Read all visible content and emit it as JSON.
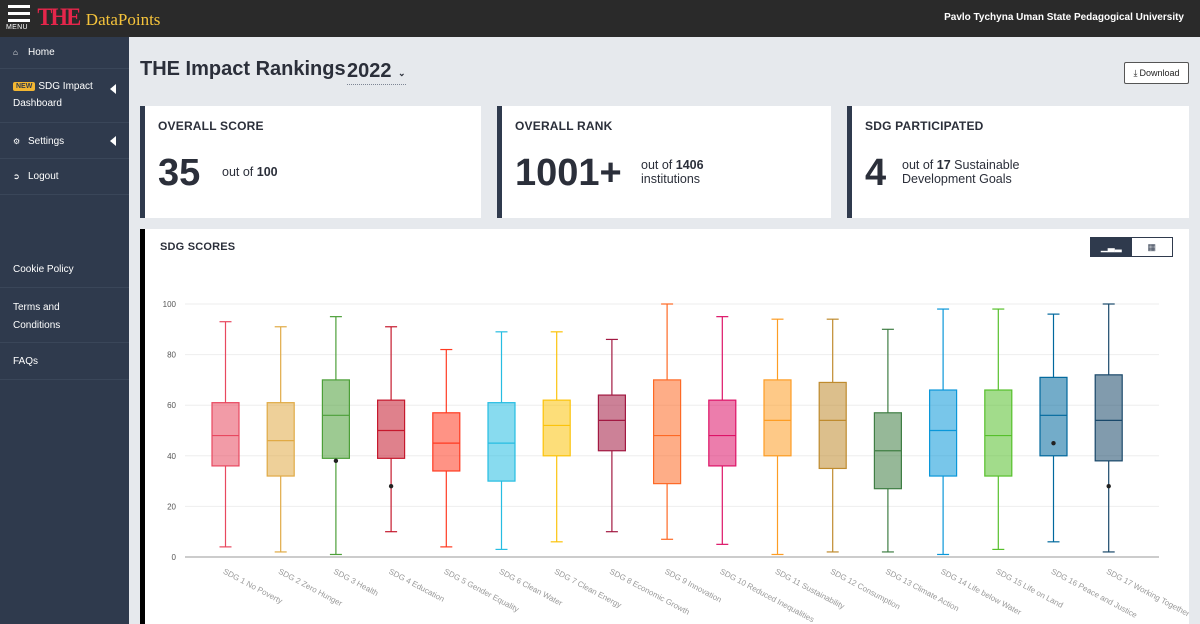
{
  "topbar": {
    "menu_label": "MENU",
    "logo_the": "THE",
    "logo_datapoints": "DataPoints",
    "university": "Pavlo Tychyna Uman State Pedagogical University"
  },
  "sidebar": {
    "home": "Home",
    "sdg_new_badge": "NEW",
    "sdg_line1": "SDG Impact",
    "sdg_line2": "Dashboard",
    "settings": "Settings",
    "logout": "Logout",
    "cookie": "Cookie Policy",
    "terms_line1": "Terms and",
    "terms_line2": "Conditions",
    "faqs": "FAQs"
  },
  "header": {
    "title": "THE Impact Rankings",
    "year": "2022",
    "download": "Download"
  },
  "cards": {
    "score": {
      "title": "OVERALL SCORE",
      "value": "35",
      "sub_prefix": "out of",
      "sub_bold": "100"
    },
    "rank": {
      "title": "OVERALL RANK",
      "value": "1001+",
      "sub_prefix": "out of",
      "sub_bold": "1406",
      "sub_line2": "institutions"
    },
    "sdg": {
      "title": "SDG PARTICIPATED",
      "value": "4",
      "sub_prefix": "out of",
      "sub_bold": "17",
      "sub_suffix": "Sustainable",
      "sub_line2": "Development Goals"
    }
  },
  "chart_section": {
    "title": "SDG SCORES"
  },
  "chart_data": {
    "type": "boxplot",
    "ylim": [
      0,
      100
    ],
    "yticks": [
      0,
      20,
      40,
      60,
      80,
      100
    ],
    "grid": true,
    "categories": [
      {
        "label": "SDG 1 No Poverty",
        "color": "#e8485f",
        "min": 4,
        "q1": 36,
        "median": 48,
        "q3": 61,
        "max": 93,
        "marker": null
      },
      {
        "label": "SDG 2 Zero Hunger",
        "color": "#e0aa45",
        "min": 2,
        "q1": 32,
        "median": 46,
        "q3": 61,
        "max": 91,
        "marker": null
      },
      {
        "label": "SDG 3 Health",
        "color": "#4c9f38",
        "min": 1,
        "q1": 39,
        "median": 56,
        "q3": 70,
        "max": 95,
        "marker": 38
      },
      {
        "label": "SDG 4 Education",
        "color": "#c5192d",
        "min": 10,
        "q1": 39,
        "median": 50,
        "q3": 62,
        "max": 91,
        "marker": 28
      },
      {
        "label": "SDG 5 Gender Equality",
        "color": "#ff3a21",
        "min": 4,
        "q1": 34,
        "median": 45,
        "q3": 57,
        "max": 82,
        "marker": null
      },
      {
        "label": "SDG 6 Clean Water",
        "color": "#26bde2",
        "min": 3,
        "q1": 30,
        "median": 45,
        "q3": 61,
        "max": 89,
        "marker": null
      },
      {
        "label": "SDG 7 Clean Energy",
        "color": "#fcc30b",
        "min": 6,
        "q1": 40,
        "median": 52,
        "q3": 62,
        "max": 89,
        "marker": null
      },
      {
        "label": "SDG 8 Economic Growth",
        "color": "#a21942",
        "min": 10,
        "q1": 42,
        "median": 54,
        "q3": 64,
        "max": 86,
        "marker": null
      },
      {
        "label": "SDG 9 Innovation",
        "color": "#fd6925",
        "min": 7,
        "q1": 29,
        "median": 48,
        "q3": 70,
        "max": 100,
        "marker": null
      },
      {
        "label": "SDG 10 Reduced Inequalities",
        "color": "#dd1367",
        "min": 5,
        "q1": 36,
        "median": 48,
        "q3": 62,
        "max": 95,
        "marker": null
      },
      {
        "label": "SDG 11 Sustainability",
        "color": "#fd9d24",
        "min": 1,
        "q1": 40,
        "median": 54,
        "q3": 70,
        "max": 94,
        "marker": null
      },
      {
        "label": "SDG 12 Consumption",
        "color": "#bf8b2e",
        "min": 2,
        "q1": 35,
        "median": 54,
        "q3": 69,
        "max": 94,
        "marker": null
      },
      {
        "label": "SDG 13 Climate Action",
        "color": "#3f7e44",
        "min": 2,
        "q1": 27,
        "median": 42,
        "q3": 57,
        "max": 90,
        "marker": null
      },
      {
        "label": "SDG 14 Life below Water",
        "color": "#0a97d9",
        "min": 1,
        "q1": 32,
        "median": 50,
        "q3": 66,
        "max": 98,
        "marker": null
      },
      {
        "label": "SDG 15 Life on Land",
        "color": "#56c02b",
        "min": 3,
        "q1": 32,
        "median": 48,
        "q3": 66,
        "max": 98,
        "marker": null
      },
      {
        "label": "SDG 16 Peace and Justice",
        "color": "#00689d",
        "min": 6,
        "q1": 40,
        "median": 56,
        "q3": 71,
        "max": 96,
        "marker": 45
      },
      {
        "label": "SDG 17 Working Together",
        "color": "#19486a",
        "min": 2,
        "q1": 38,
        "median": 54,
        "q3": 72,
        "max": 100,
        "marker": 28
      }
    ]
  }
}
